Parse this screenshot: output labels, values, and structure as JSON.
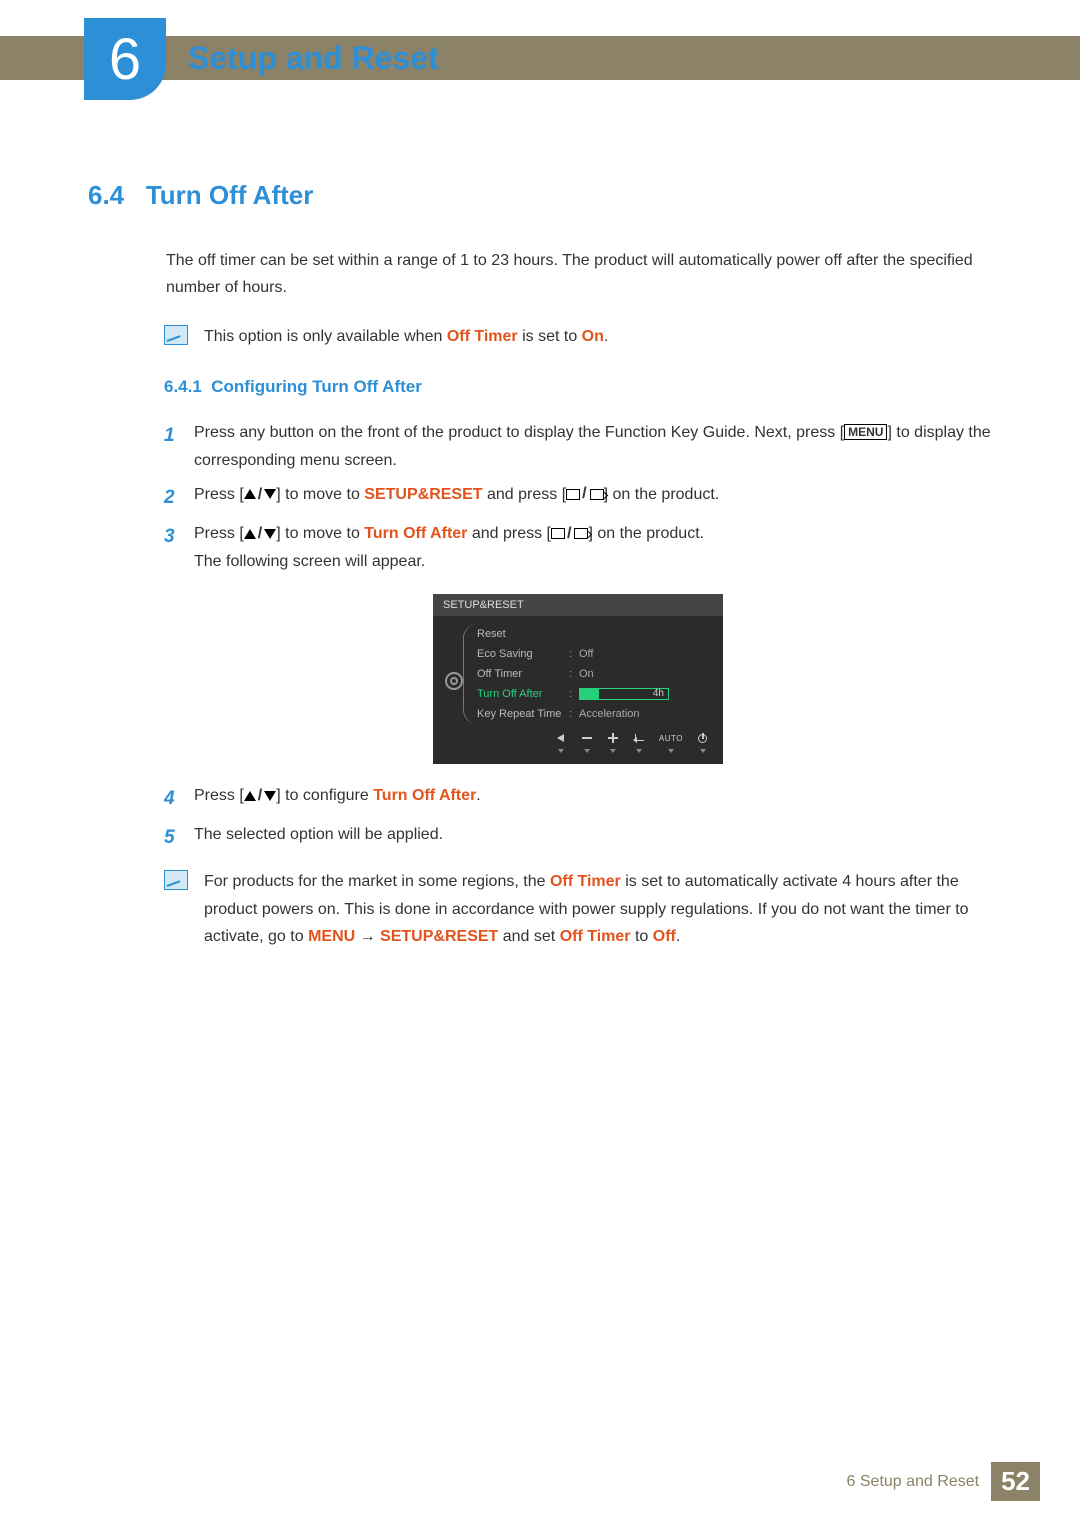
{
  "chapter": {
    "number": "6",
    "title": "Setup and Reset"
  },
  "section": {
    "number": "6.4",
    "title": "Turn Off After"
  },
  "intro": "The off timer can be set within a range of 1 to 23 hours. The product will automatically power off after the specified number of hours.",
  "note1": {
    "prefix": "This option is only available when ",
    "hl1": "Off Timer",
    "mid": " is set to ",
    "hl2": "On",
    "suffix": "."
  },
  "subsection": {
    "number": "6.4.1",
    "title": "Configuring Turn Off After"
  },
  "steps": {
    "s1a": "Press any button on the front of the product to display the Function Key Guide. Next, press [",
    "s1_menu": "MENU",
    "s1b": "] to display the corresponding menu screen.",
    "s2a": "Press [",
    "s2b": "] to move to ",
    "s2_hl": "SETUP&RESET",
    "s2c": " and press [",
    "s2d": "] on the product.",
    "s3a": "Press [",
    "s3b": "] to move to ",
    "s3_hl": "Turn Off After",
    "s3c": " and press [",
    "s3d": "] on the product.",
    "s3e": "The following screen will appear.",
    "s4a": "Press [",
    "s4b": "] to configure ",
    "s4_hl": "Turn Off After",
    "s4c": ".",
    "s5": "The selected option will be applied."
  },
  "osd": {
    "title": "SETUP&RESET",
    "rows": [
      {
        "label": "Reset",
        "value": ""
      },
      {
        "label": "Eco Saving",
        "value": "Off"
      },
      {
        "label": "Off Timer",
        "value": "On"
      },
      {
        "label": "Turn Off After",
        "value": "4h",
        "active": true,
        "bar": true
      },
      {
        "label": "Key Repeat Time",
        "value": "Acceleration"
      }
    ],
    "auto": "AUTO"
  },
  "note2": {
    "a": "For products for the market in some regions, the ",
    "hl1": "Off Timer",
    "b": " is set to automatically activate 4 hours after the product powers on. This is done in accordance with power supply regulations. If you do not want the timer to activate, go to ",
    "hl2": "MENU",
    "arrow": "  →  ",
    "hl3": "SETUP&RESET",
    "c": " and set ",
    "hl4": "Off Timer",
    "d": " to ",
    "hl5": "Off",
    "e": "."
  },
  "footer": {
    "text": "6 Setup and Reset",
    "page": "52"
  }
}
